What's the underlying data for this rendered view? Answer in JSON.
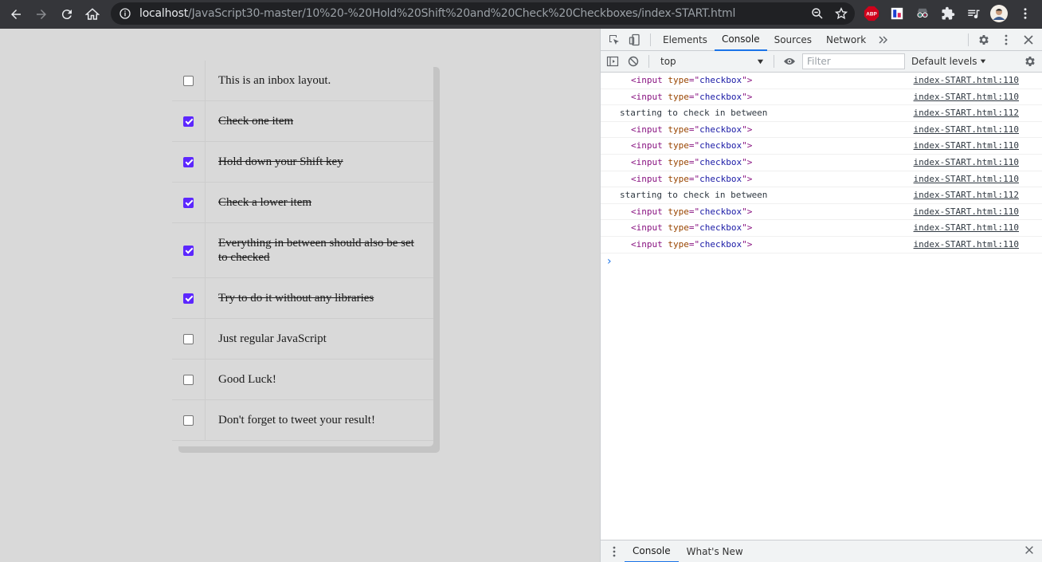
{
  "browser": {
    "url_host": "localhost",
    "url_path": "/JavaScript30-master/10%20-%20Hold%20Shift%20and%20Check%20Checkboxes/index-START.html",
    "extensions": [
      "ABP"
    ]
  },
  "inbox": {
    "items": [
      {
        "label": "This is an inbox layout.",
        "checked": false
      },
      {
        "label": "Check one item",
        "checked": true
      },
      {
        "label": "Hold down your Shift key",
        "checked": true
      },
      {
        "label": "Check a lower item",
        "checked": true
      },
      {
        "label": "Everything in between should also be set to checked",
        "checked": true
      },
      {
        "label": "Try to do it without any libraries",
        "checked": true
      },
      {
        "label": "Just regular JavaScript",
        "checked": false
      },
      {
        "label": "Good Luck!",
        "checked": false
      },
      {
        "label": "Don't forget to tweet your result!",
        "checked": false
      }
    ]
  },
  "devtools": {
    "tabs": [
      "Elements",
      "Console",
      "Sources",
      "Network"
    ],
    "active_tab": "Console",
    "context": "top",
    "filter_placeholder": "Filter",
    "levels": "Default levels",
    "logs": [
      {
        "type": "element",
        "tag": "input",
        "attr": "type",
        "value": "checkbox",
        "source": "index-START.html:110"
      },
      {
        "type": "element",
        "tag": "input",
        "attr": "type",
        "value": "checkbox",
        "source": "index-START.html:110"
      },
      {
        "type": "text",
        "text": "starting to check in between",
        "source": "index-START.html:112"
      },
      {
        "type": "element",
        "tag": "input",
        "attr": "type",
        "value": "checkbox",
        "source": "index-START.html:110"
      },
      {
        "type": "element",
        "tag": "input",
        "attr": "type",
        "value": "checkbox",
        "source": "index-START.html:110"
      },
      {
        "type": "element",
        "tag": "input",
        "attr": "type",
        "value": "checkbox",
        "source": "index-START.html:110"
      },
      {
        "type": "element",
        "tag": "input",
        "attr": "type",
        "value": "checkbox",
        "source": "index-START.html:110"
      },
      {
        "type": "text",
        "text": "starting to check in between",
        "source": "index-START.html:112"
      },
      {
        "type": "element",
        "tag": "input",
        "attr": "type",
        "value": "checkbox",
        "source": "index-START.html:110"
      },
      {
        "type": "element",
        "tag": "input",
        "attr": "type",
        "value": "checkbox",
        "source": "index-START.html:110"
      },
      {
        "type": "element",
        "tag": "input",
        "attr": "type",
        "value": "checkbox",
        "source": "index-START.html:110"
      }
    ],
    "drawer_tabs": [
      "Console",
      "What's New"
    ],
    "drawer_active": "Console"
  },
  "colors": {
    "checkbox_accent": "#5c27fe",
    "chrome_bg": "#35363a",
    "page_bg": "#d9d9d9"
  }
}
